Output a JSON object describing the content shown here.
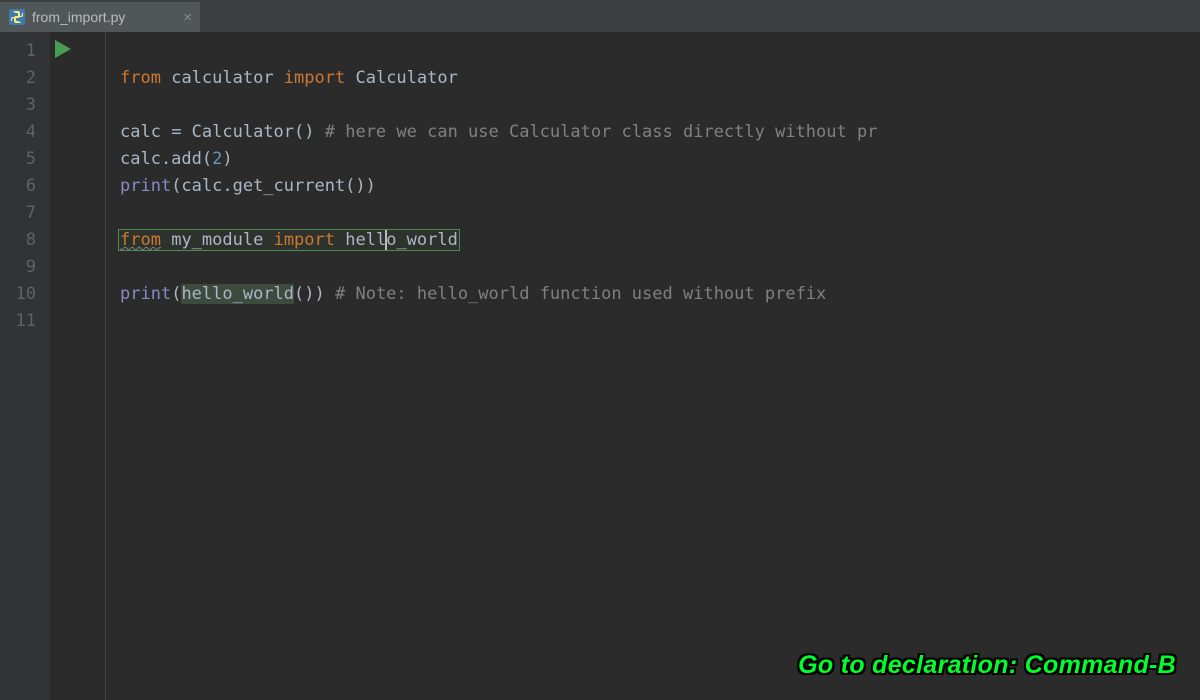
{
  "tab": {
    "filename": "from_import.py",
    "close_glyph": "×"
  },
  "gutter": {
    "lines": [
      "1",
      "2",
      "3",
      "4",
      "5",
      "6",
      "7",
      "8",
      "9",
      "10",
      "11"
    ]
  },
  "code": {
    "line2": {
      "kw_from": "from",
      "module": "calculator",
      "kw_import": "import",
      "name": "Calculator"
    },
    "line4": {
      "var": "calc",
      "assign_cls": "= Calculator()",
      "comment": "# here we can use Calculator class directly without pr"
    },
    "line5": {
      "text_a": "calc.add(",
      "num": "2",
      "text_b": ")"
    },
    "line6": {
      "builtin": "print",
      "rest": "(calc.get_current())"
    },
    "line8": {
      "kw_from": "from",
      "module": "my_module",
      "kw_import": "import",
      "name_a": "hell",
      "name_b": "o_world"
    },
    "line10": {
      "builtin": "print",
      "paren_open": "(",
      "call": "hello_world",
      "paren_rest": "())",
      "comment": "# Note: hello_world function used without prefix"
    }
  },
  "hint": "Go to declaration: Command-B"
}
